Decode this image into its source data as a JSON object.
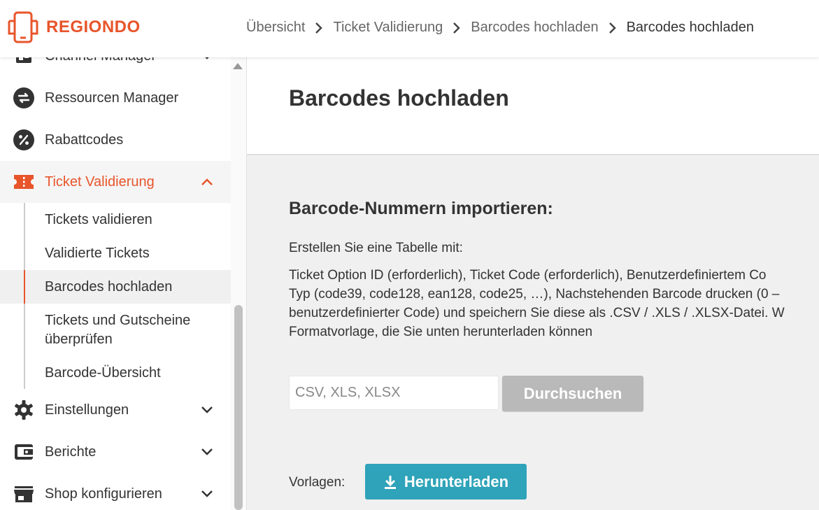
{
  "brand": {
    "name": "REGIONDO",
    "color": "#e8552b"
  },
  "breadcrumb": [
    "Übersicht",
    "Ticket Validierung",
    "Barcodes hochladen",
    "Barcodes hochladen"
  ],
  "sidebar": {
    "items": [
      {
        "label": "Channel Manager",
        "icon": "channel-manager-icon"
      },
      {
        "label": "Ressourcen Manager",
        "icon": "swap-icon"
      },
      {
        "label": "Rabattcodes",
        "icon": "percent-icon"
      },
      {
        "label": "Ticket Validierung",
        "icon": "ticket-icon",
        "active": true
      },
      {
        "label": "Einstellungen",
        "icon": "gear-icon"
      },
      {
        "label": "Berichte",
        "icon": "wallet-icon"
      },
      {
        "label": "Shop konfigurieren",
        "icon": "store-icon"
      }
    ],
    "subitems": [
      {
        "label": "Tickets validieren"
      },
      {
        "label": "Validierte Tickets"
      },
      {
        "label": "Barcodes hochladen",
        "active": true
      },
      {
        "label": "Tickets und Gutscheine überprüfen"
      },
      {
        "label": "Barcode-Übersicht"
      }
    ]
  },
  "main": {
    "title": "Barcodes hochladen",
    "section_title": "Barcode-Nummern importieren:",
    "intro": "Erstellen Sie eine Tabelle mit:",
    "desc_lines": [
      "Ticket Option ID (erforderlich), Ticket Code (erforderlich), Benutzerdefiniertem Co",
      "Typ (code39, code128, ean128, code25, …), Nachstehenden Barcode drucken (0 –",
      "benutzerdefinierter Code) und speichern Sie diese als .CSV / .XLS / .XLSX-Datei. W",
      "Formatvorlage, die Sie unten herunterladen können"
    ],
    "file_placeholder": "CSV, XLS, XLSX",
    "browse_label": "Durchsuchen",
    "templates_label": "Vorlagen:",
    "download_label": "Herunterladen"
  },
  "colors": {
    "accent": "#e8552b",
    "download": "#2ea3b9",
    "browse_disabled": "#b9b9b9"
  }
}
